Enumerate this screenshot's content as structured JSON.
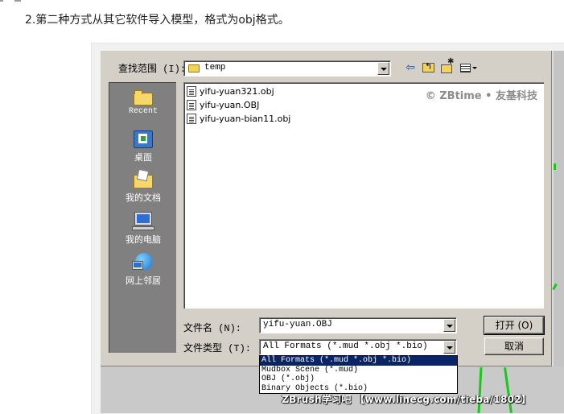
{
  "article": {
    "instruction": "2.第二种方式从其它软件导入模型，格式为obj格式。"
  },
  "dialog": {
    "lookin_label": "查找范围 (I):",
    "lookin_value": "temp",
    "toolbar_icons": [
      "back-arrow-icon",
      "up-folder-icon",
      "new-folder-icon",
      "view-menu-icon"
    ],
    "places": [
      {
        "label": "Recent",
        "icon": "recent-folder-icon"
      },
      {
        "label": "桌面",
        "icon": "desktop-icon"
      },
      {
        "label": "我的文档",
        "icon": "my-documents-icon"
      },
      {
        "label": "我的电脑",
        "icon": "my-computer-icon"
      },
      {
        "label": "网上邻居",
        "icon": "network-icon"
      }
    ],
    "files": [
      "yifu-yuan321.obj",
      "yifu-yuan.OBJ",
      "yifu-yuan-bian11.obj"
    ],
    "watermark": "© ZBtime • 友基科技",
    "filename_label": "文件名 (N):",
    "filename_value": "yifu-yuan.OBJ",
    "filetype_label": "文件类型 (T):",
    "filetype_value": "All Formats (*.mud *.obj *.bio)",
    "open_button": "打开 (O)",
    "cancel_button": "取消",
    "filetype_options": [
      "All Formats (*.mud *.obj *.bio)",
      "Mudbox Scene (*.mud)",
      "OBJ (*.obj)",
      "Binary Objects (*.bio)"
    ],
    "selected_option_index": 0
  },
  "caption": "ZBrush学习吧 【www.linecg.com/tieba/1802】",
  "colors": {
    "dialog_face": "#d4d0c8",
    "places_bar": "#808080",
    "selection": "#0a246a",
    "accent_green": "#18c818"
  }
}
